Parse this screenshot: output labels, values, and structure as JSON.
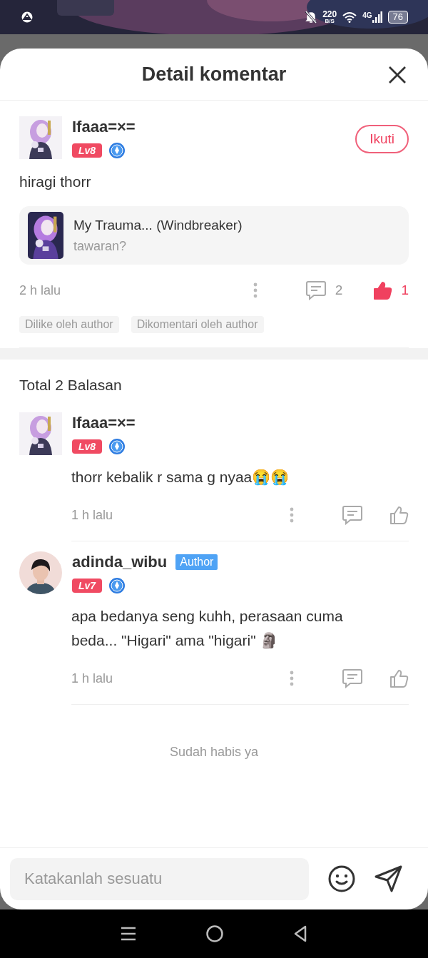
{
  "status_bar": {
    "speed": "220",
    "speed_unit": "B/S",
    "network": "4G",
    "battery": "76"
  },
  "header": {
    "title": "Detail komentar"
  },
  "comment": {
    "user": "Ifaaa=×=",
    "level": "Lv8",
    "follow": "Ikuti",
    "text": "hiragi thorr",
    "work": {
      "title": "My Trauma... (Windbreaker)",
      "subtitle": "tawaran?"
    },
    "time": "2 h lalu",
    "replies": "2",
    "likes": "1",
    "liked": true,
    "tags": [
      "Dilike oleh author",
      "Dikomentari oleh author"
    ]
  },
  "replies_header": "Total 2 Balasan",
  "replies": [
    {
      "user": "Ifaaa=×=",
      "level": "Lv8",
      "text": "thorr kebalik r sama g nyaa😭😭",
      "time": "1 h lalu",
      "liked": false
    },
    {
      "user": "adinda_wibu",
      "avatar": {
        "kind": "person"
      },
      "badge": "Author",
      "level": "Lv7",
      "text": "apa bedanya seng kuhh, perasaan cuma beda... \"Higari\" ama \"higari\" 🗿",
      "time": "1 h lalu",
      "liked": false
    }
  ],
  "end_note": "Sudah habis ya",
  "input": {
    "placeholder": "Katakanlah sesuatu"
  }
}
